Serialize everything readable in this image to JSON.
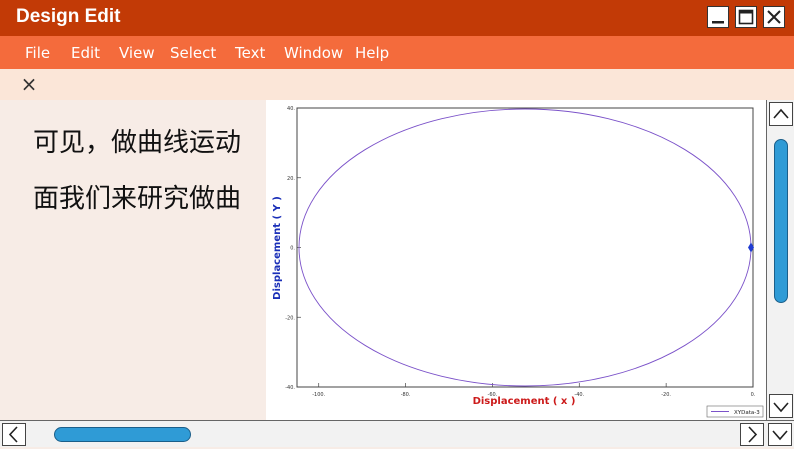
{
  "window": {
    "title": "Design Edit"
  },
  "menu": [
    "File",
    "Edit",
    "View",
    "Select",
    "Text",
    "Window",
    "Help"
  ],
  "toolbar": {
    "close_glyph": "×"
  },
  "document": {
    "lines": [
      "可见，做曲线运动",
      "面我们来研究做曲"
    ]
  },
  "chart_data": {
    "type": "line",
    "xlabel": "Displacement ( x )",
    "ylabel": "Displacement ( Y )",
    "xlim": [
      -105,
      0
    ],
    "ylim": [
      -40,
      40
    ],
    "x_ticks": [
      -100,
      -80,
      -60,
      -40,
      -20,
      0
    ],
    "x_tick_labels": [
      "-100.",
      "-80.",
      "-60.",
      "-40.",
      "-20.",
      "0."
    ],
    "y_ticks": [
      -40,
      -20,
      0,
      20,
      40
    ],
    "y_tick_labels": [
      "-40.",
      "-20.",
      "0.",
      "20.",
      "40."
    ],
    "legend": "bottom-right",
    "series": [
      {
        "name": "XYData-3",
        "color": "#7b52c9",
        "shape": "ellipse",
        "center": [
          -52.5,
          0
        ],
        "semi_axes": [
          52.5,
          40
        ],
        "marker_point": [
          0,
          0
        ]
      }
    ]
  },
  "colors": {
    "titlebar": "#c23a06",
    "menubar": "#f46b3c",
    "toolbar": "#fbe6d8",
    "scroll_thumb": "#2f9bd6",
    "xlabel": "#cc1a1a",
    "ylabel": "#1a2fb8",
    "marker": "#1f3bd1"
  },
  "icons": {
    "minimize": "minimize-icon",
    "maximize": "maximize-icon",
    "close": "close-icon",
    "up": "chevron-up-icon",
    "down": "chevron-down-icon",
    "left": "chevron-left-icon",
    "right": "chevron-right-icon"
  }
}
